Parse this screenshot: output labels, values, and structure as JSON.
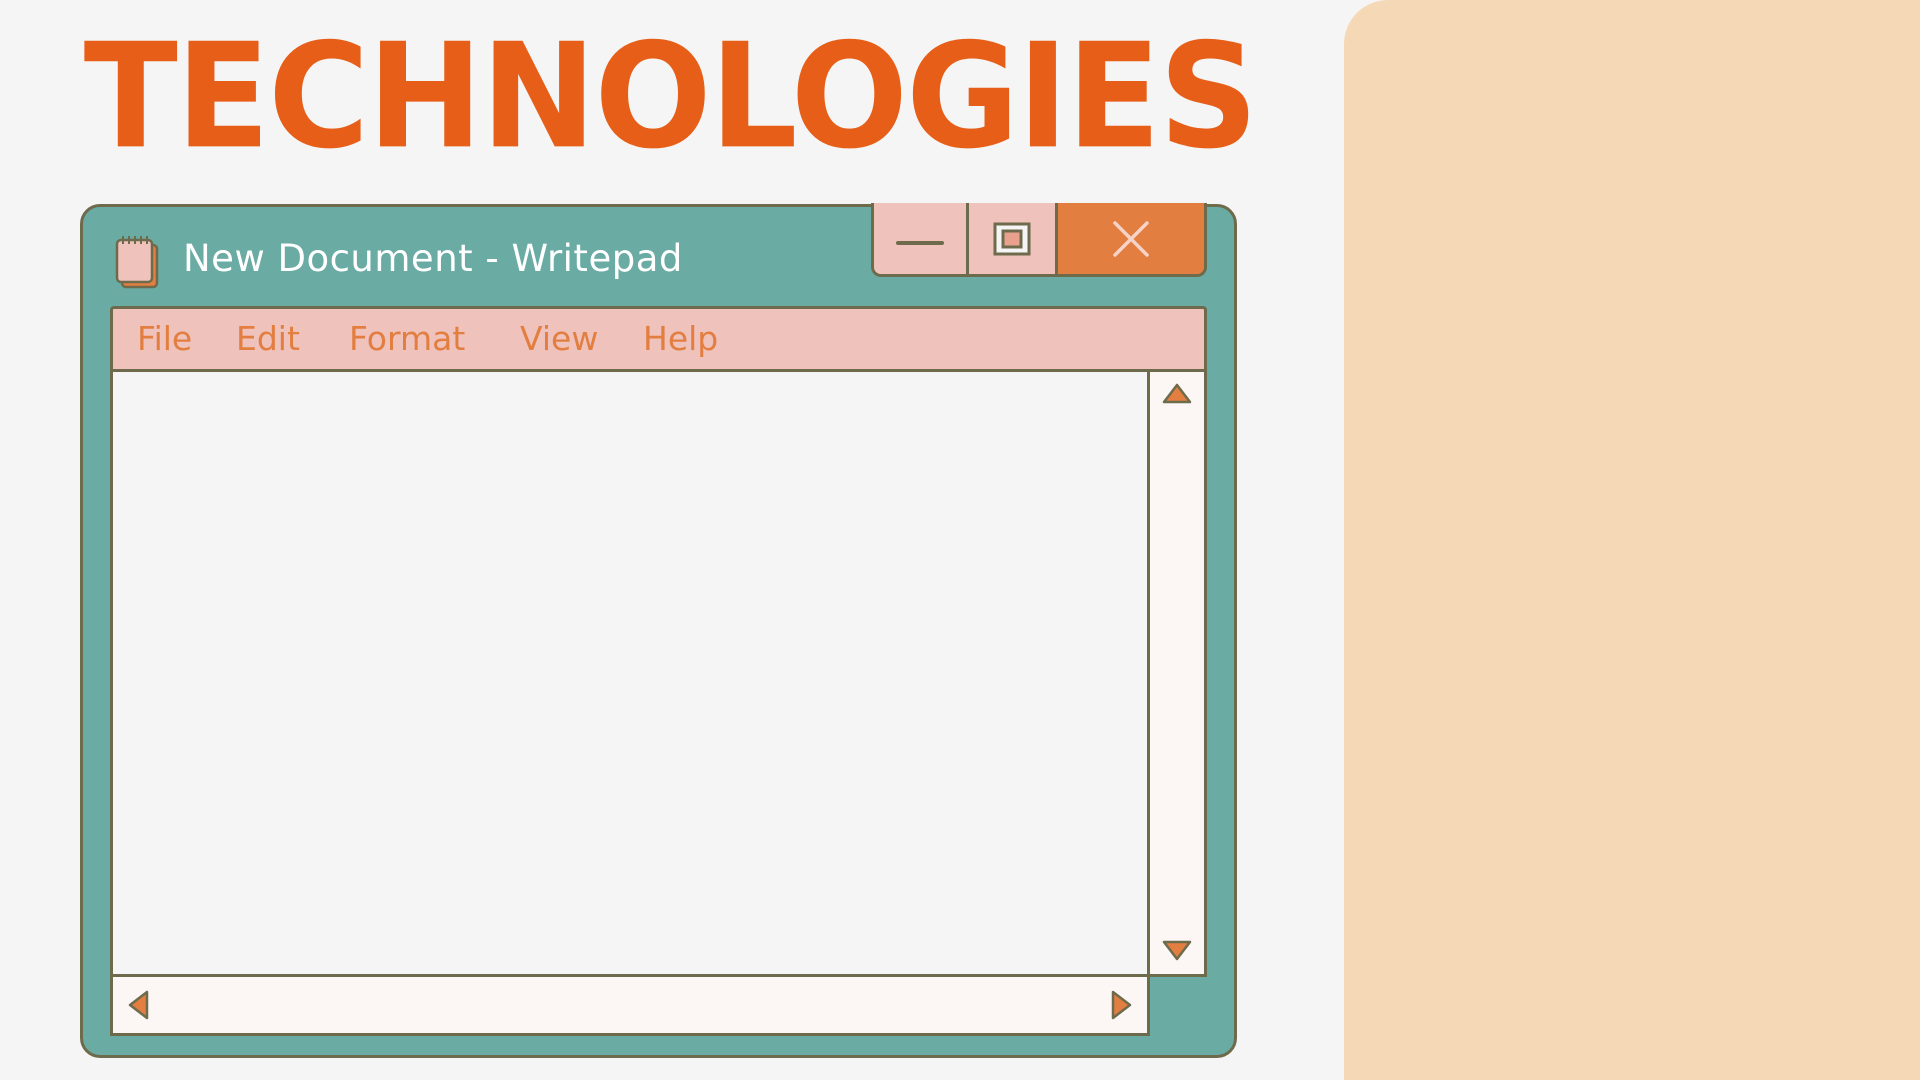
{
  "heading": "TECHNOLOGIES",
  "window": {
    "title": "New Document - Writepad",
    "icon": "notepad-icon",
    "controls": {
      "minimize_icon": "minimize-icon",
      "maximize_icon": "maximize-icon",
      "close_icon": "close-icon"
    },
    "menu": [
      "File",
      "Edit",
      "Format",
      "View",
      "Help"
    ],
    "document_text": ""
  },
  "colors": {
    "background": "#f5f5f5",
    "heading": "#e65e17",
    "side_panel": "#f5d9b6",
    "window_frame": "#6aaba4",
    "outline": "#6e6b4d",
    "menu_bar": "#f0c2bc",
    "menu_text": "#e27e40",
    "close_button": "#e27e40",
    "scrollbar": "#fcf6f4"
  }
}
